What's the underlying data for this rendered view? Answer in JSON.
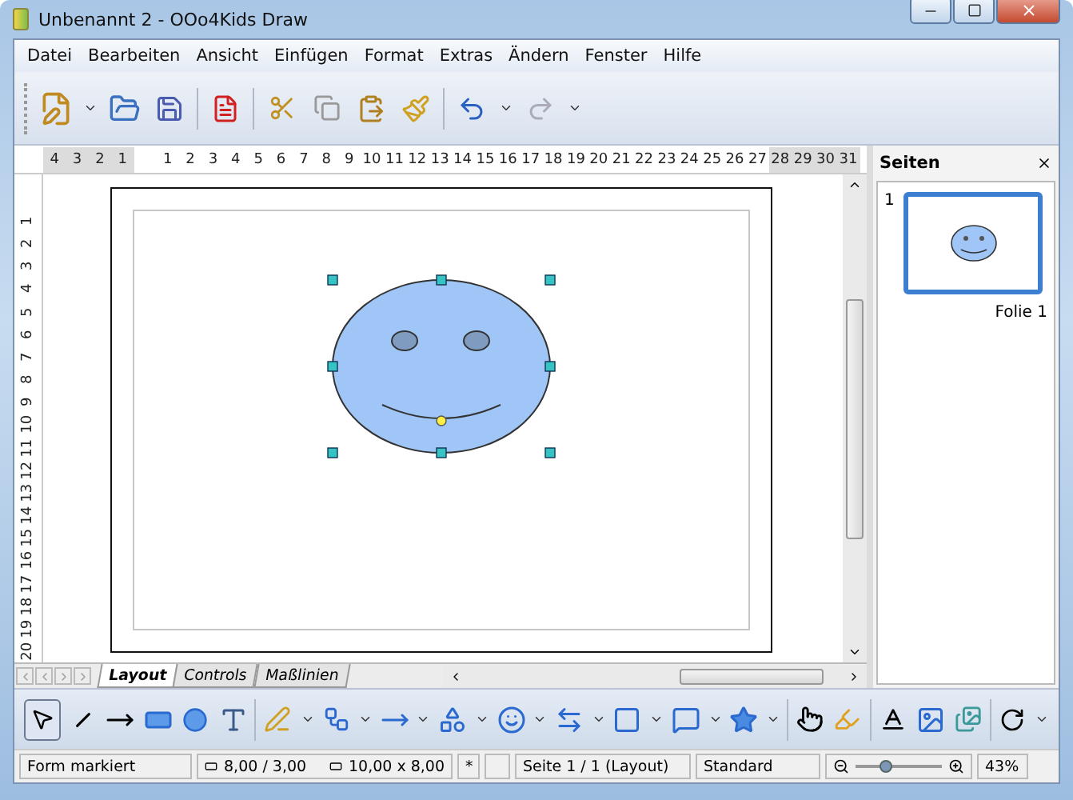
{
  "window": {
    "title": "Unbenannt 2 - OOo4Kids Draw"
  },
  "menu": [
    "Datei",
    "Bearbeiten",
    "Ansicht",
    "Einfügen",
    "Format",
    "Extras",
    "Ändern",
    "Fenster",
    "Hilfe"
  ],
  "ruler": {
    "top_labels": [
      "4",
      "3",
      "2",
      "1",
      "1",
      "2",
      "3",
      "4",
      "5",
      "6",
      "7",
      "8",
      "9",
      "10",
      "11",
      "12",
      "13",
      "14",
      "15",
      "16",
      "17",
      "18",
      "19",
      "20",
      "21",
      "22",
      "23",
      "24",
      "25",
      "26",
      "27",
      "28",
      "29",
      "30",
      "31"
    ],
    "left_labels": [
      "1",
      "2",
      "3",
      "4",
      "5",
      "6",
      "7",
      "8",
      "9",
      "10",
      "11",
      "12",
      "13",
      "14",
      "15",
      "16",
      "17",
      "18",
      "19",
      "20"
    ]
  },
  "canvas": {
    "shape": {
      "kind": "smiley",
      "selected": true
    }
  },
  "sheet_tabs": [
    {
      "label": "Layout",
      "selected": true
    },
    {
      "label": "Controls",
      "selected": false
    },
    {
      "label": "Maßlinien",
      "selected": false
    }
  ],
  "side_panel": {
    "title": "Seiten",
    "slides": [
      {
        "number": "1",
        "label": "Folie 1",
        "selected": true
      }
    ]
  },
  "drawing_toolbar": {
    "select_selected": true
  },
  "status_bar": {
    "mode": "Form markiert",
    "position": "8,00 / 3,00",
    "size": "10,00 x 8,00",
    "modified": "*",
    "page": "Seite 1 / 1 (Layout)",
    "layout": "Standard",
    "zoom": {
      "level": 0.35,
      "reading": "43%"
    }
  }
}
